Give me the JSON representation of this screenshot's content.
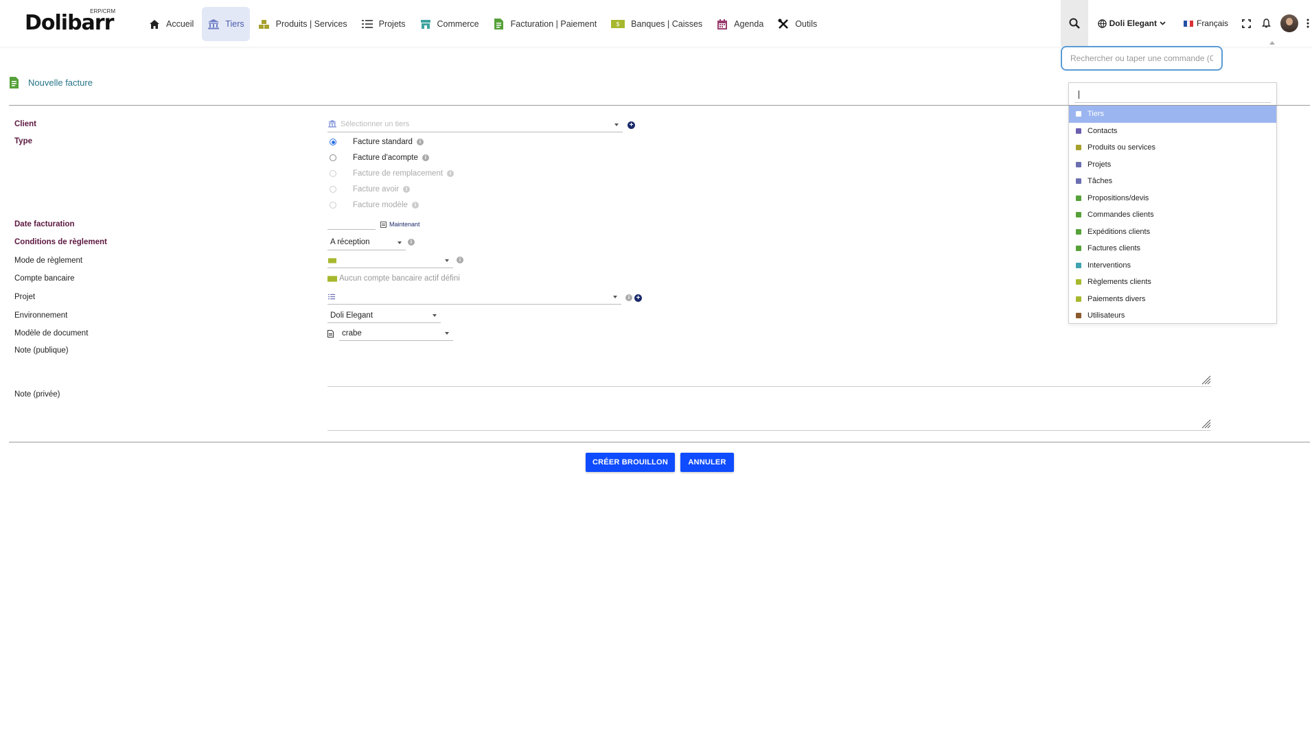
{
  "app": {
    "logo_text": "Dolibarr",
    "logo_subtext": "ERP/CRM"
  },
  "menu": [
    {
      "label": "Accueil",
      "icon": "home-icon"
    },
    {
      "label": "Tiers",
      "icon": "building-icon",
      "active": true
    },
    {
      "label": "Produits | Services",
      "icon": "cubes-icon"
    },
    {
      "label": "Projets",
      "icon": "tasks-icon"
    },
    {
      "label": "Commerce",
      "icon": "shop-icon"
    },
    {
      "label": "Facturation | Paiement",
      "icon": "invoice-icon"
    },
    {
      "label": "Banques | Caisses",
      "icon": "money-icon"
    },
    {
      "label": "Agenda",
      "icon": "calendar-icon"
    },
    {
      "label": "Outils",
      "icon": "tools-icon"
    }
  ],
  "topright": {
    "entity": "Doli Elegant",
    "language": "Français"
  },
  "search": {
    "placeholder": "Rechercher ou taper une commande (Ctrl + G)",
    "filter_value": "",
    "items": [
      {
        "label": "Tiers",
        "icon": "building-icon",
        "color": "#7d8fd8"
      },
      {
        "label": "Contacts",
        "icon": "contact-icon",
        "color": "#6b5fb0"
      },
      {
        "label": "Produits ou services",
        "icon": "cubes-icon",
        "color": "#a7a12e"
      },
      {
        "label": "Projets",
        "icon": "tasks-icon",
        "color": "#6b6fb0"
      },
      {
        "label": "Tâches",
        "icon": "tasks-icon",
        "color": "#6b6fb0"
      },
      {
        "label": "Propositions/devis",
        "icon": "proposal-icon",
        "color": "#56a13a"
      },
      {
        "label": "Commandes clients",
        "icon": "order-icon",
        "color": "#56a13a"
      },
      {
        "label": "Expéditions clients",
        "icon": "shipping-icon",
        "color": "#56a13a"
      },
      {
        "label": "Factures clients",
        "icon": "invoice-icon",
        "color": "#56a13a"
      },
      {
        "label": "Interventions",
        "icon": "truck-icon",
        "color": "#3fa3b0"
      },
      {
        "label": "Règlements clients",
        "icon": "money-icon",
        "color": "#a7b82e"
      },
      {
        "label": "Paiements divers",
        "icon": "money-icon",
        "color": "#a7b82e"
      },
      {
        "label": "Utilisateurs",
        "icon": "user-icon",
        "color": "#8a5a2e"
      }
    ],
    "selected_index": 0
  },
  "page": {
    "title": "Nouvelle facture"
  },
  "form": {
    "client_label": "Client",
    "client_placeholder": "Sélectionner un tiers",
    "type_label": "Type",
    "types": [
      {
        "label": "Facture standard",
        "checked": true,
        "disabled": false
      },
      {
        "label": "Facture d'acompte",
        "checked": false,
        "disabled": false
      },
      {
        "label": "Facture de remplacement",
        "checked": false,
        "disabled": true
      },
      {
        "label": "Facture avoir",
        "checked": false,
        "disabled": true
      },
      {
        "label": "Facture modèle",
        "checked": false,
        "disabled": true
      }
    ],
    "date_label": "Date facturation",
    "date_now_label": "Maintenant",
    "conditions_label": "Conditions de règlement",
    "conditions_value": "A réception",
    "mode_label": "Mode de règlement",
    "account_label": "Compte bancaire",
    "account_value": "Aucun compte bancaire actif défini",
    "project_label": "Projet",
    "env_label": "Environnement",
    "env_value": "Doli Elegant",
    "model_label": "Modèle de document",
    "model_value": "crabe",
    "note_public_label": "Note (publique)",
    "note_private_label": "Note (privée)"
  },
  "buttons": {
    "create_draft": "CRÉER BROUILLON",
    "cancel": "ANNULER"
  },
  "colors": {
    "accent": "#0f4cff",
    "required_label": "#5c1840",
    "title": "#267488"
  }
}
